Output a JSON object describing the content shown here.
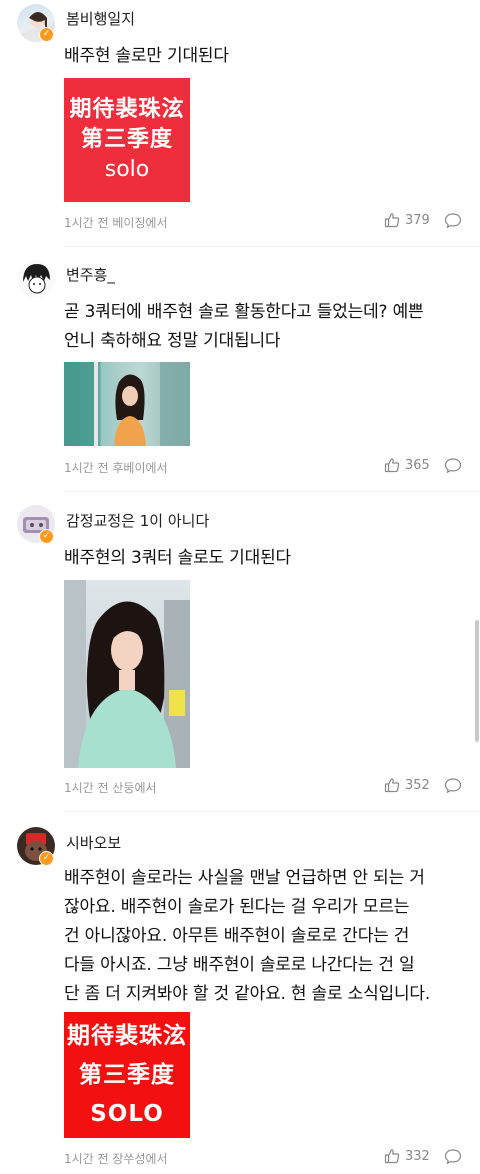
{
  "comments": [
    {
      "username": "봄비행일지",
      "text": [
        "배주현 솔로만 기대된다"
      ],
      "poster_lines": [
        "期待裴珠泫",
        "第三季度",
        "solo"
      ],
      "meta": "1시간 전 베이징에서",
      "likes": "379",
      "verified": true
    },
    {
      "username": "변주흥_",
      "text": [
        "곧 3쿼터에 배주현 솔로 활동한다고 들었는데? 예쁜",
        "언니 축하해요 정말 기대됩니다"
      ],
      "meta": "1시간 전 후베이에서",
      "likes": "365",
      "verified": false
    },
    {
      "username": "감정교정은 1이 아니다",
      "text": [
        "배주현의 3쿼터 솔로도 기대된다"
      ],
      "meta": "1시간 전 산둥에서",
      "likes": "352",
      "verified": true
    },
    {
      "username": "시바오보",
      "text": [
        "배주현이 솔로라는 사실을 맨날 언급하면 안 되는 거",
        "잖아요. 배주현이 솔로가 된다는 걸 우리가 모르는",
        "건 아니잖아요. 아무튼 배주현이 솔로로 간다는 건",
        "다들 아시죠. 그냥 배주현이 솔로로 나간다는 건 일",
        "단 좀 더 지켜봐야 할 것 같아요. 현 솔로 소식입니다."
      ],
      "poster_lines": [
        "期待裴珠泫",
        "第三季度",
        "SOLO"
      ],
      "meta": "1시간 전 장쑤성에서",
      "likes": "332",
      "verified": true
    }
  ],
  "icons": {
    "like": "thumbs-up-icon",
    "reply": "comment-bubble-icon",
    "verified": "verified-badge-icon"
  },
  "colors": {
    "badge": "#ff9a1f",
    "poster_red": "#ee2e3c",
    "text_gray": "#999999"
  }
}
